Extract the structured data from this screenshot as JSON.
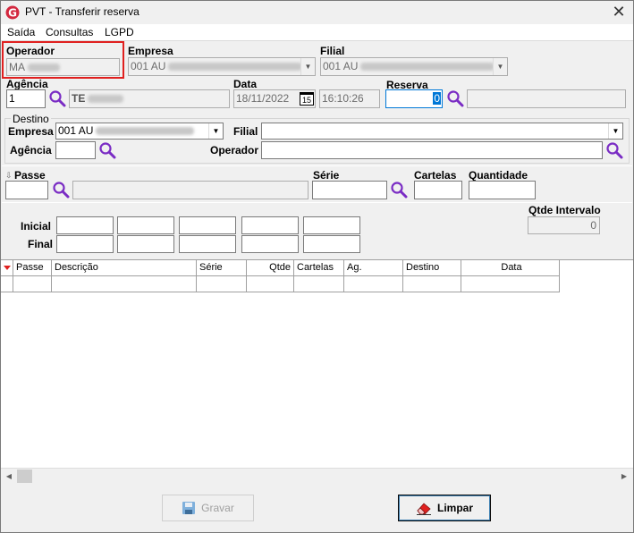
{
  "window": {
    "title": "PVT - Transferir reserva"
  },
  "menu": [
    "Saída",
    "Consultas",
    "LGPD"
  ],
  "form": {
    "operador_label": "Operador",
    "operador_value": "MA",
    "empresa_label": "Empresa",
    "empresa_value": "001 AU",
    "filial_label": "Filial",
    "filial_value": "001 AU",
    "agencia_label": "Agência",
    "agencia_value": "1",
    "agencia_name": "TE",
    "data_label": "Data",
    "data_value": "18/11/2022",
    "calendar_value": "15",
    "hora_value": "16:10:26",
    "reserva_label": "Reserva",
    "reserva_value": "0"
  },
  "destino": {
    "group_label": "Destino",
    "empresa_label": "Empresa",
    "empresa_value": "001 AU",
    "filial_label": "Filial",
    "filial_value": "",
    "agencia_label": "Agência",
    "agencia_value": "",
    "operador_label": "Operador",
    "operador_value": ""
  },
  "passe": {
    "passe_label": "Passe",
    "serie_label": "Série",
    "cartelas_label": "Cartelas",
    "quantidade_label": "Quantidade"
  },
  "intervalo": {
    "inicial_label": "Inicial",
    "final_label": "Final",
    "qtde_label": "Qtde Intervalo",
    "qtde_value": "0"
  },
  "grid": {
    "columns": [
      "Passe",
      "Descrição",
      "Série",
      "Qtde",
      "Cartelas",
      "Ag.",
      "Destino",
      "Data"
    ]
  },
  "buttons": {
    "gravar": "Gravar",
    "limpar": "Limpar"
  },
  "colors": {
    "logo": "#d3283f",
    "highlight": "#e0201f",
    "search_icon": "#7a2cc4",
    "focus": "#0078d7"
  }
}
